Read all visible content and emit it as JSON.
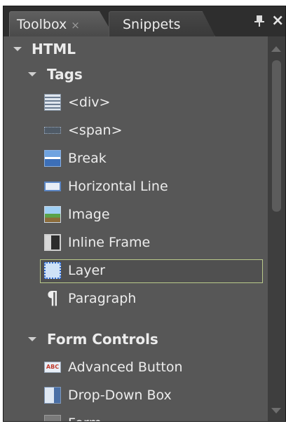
{
  "tabs": [
    {
      "label": "Toolbox",
      "close": "×",
      "active": true
    },
    {
      "label": "Snippets",
      "active": false
    }
  ],
  "panel_controls": {
    "pin_icon": "pin-icon",
    "close_glyph": "×"
  },
  "tree": {
    "root_label": "HTML",
    "tags_label": "Tags",
    "tags": [
      {
        "label": "<div>",
        "icon": "div-icon"
      },
      {
        "label": "<span>",
        "icon": "span-icon"
      },
      {
        "label": "Break",
        "icon": "break-icon"
      },
      {
        "label": "Horizontal Line",
        "icon": "horizontal-line-icon"
      },
      {
        "label": "Image",
        "icon": "image-icon"
      },
      {
        "label": "Inline Frame",
        "icon": "inline-frame-icon"
      },
      {
        "label": "Layer",
        "icon": "layer-icon",
        "selected": true
      },
      {
        "label": "Paragraph",
        "icon": "paragraph-icon"
      }
    ],
    "form_controls_label": "Form Controls",
    "form_controls": [
      {
        "label": "Advanced Button",
        "icon": "advanced-button-icon",
        "icon_text": "ABC"
      },
      {
        "label": "Drop-Down Box",
        "icon": "drop-down-box-icon"
      },
      {
        "label": "Form",
        "icon": "form-icon"
      }
    ]
  },
  "colors": {
    "panel_bg": "#575757",
    "tab_strip_bg": "#2e2e2e",
    "selection_border": "#b9c98a",
    "text": "#ececec"
  }
}
